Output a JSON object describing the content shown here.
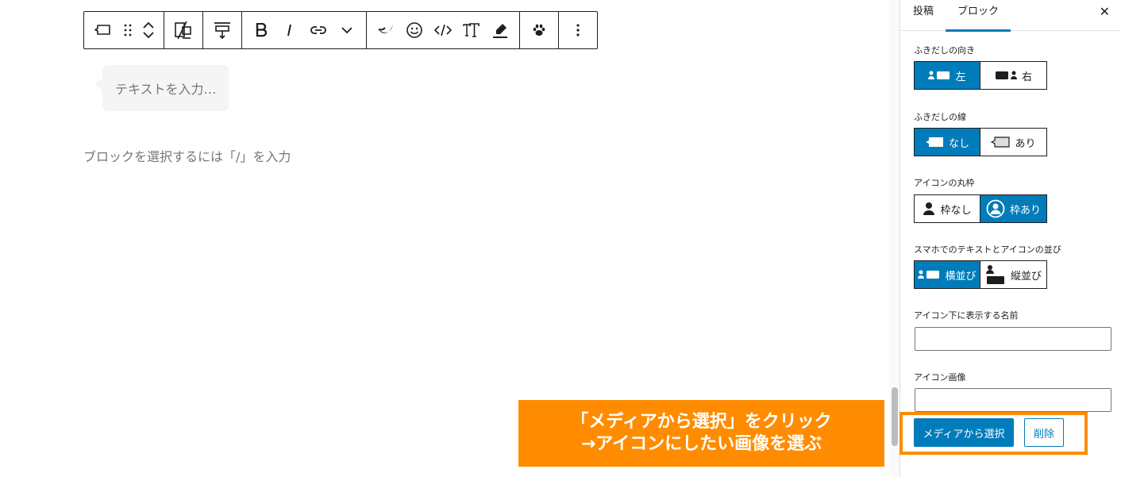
{
  "editor": {
    "bubble_placeholder": "テキストを入力…",
    "block_prompt": "ブロックを選択するには「/」を入力"
  },
  "toolbar": {
    "groups": [
      [
        "balloon-block-icon",
        "drag-handle-icon",
        "move-up-down-icon"
      ],
      [
        "mobile-hide-icon"
      ],
      [
        "align-vertical-icon"
      ],
      [
        "bold-icon",
        "italic-icon",
        "link-icon",
        "chevron-down-icon"
      ],
      [
        "brand-highlight-icon",
        "emoji-icon",
        "code-icon",
        "text-size-icon",
        "marker-icon"
      ],
      [
        "paw-icon"
      ],
      [
        "more-options-icon"
      ]
    ]
  },
  "sidebar": {
    "tabs": [
      {
        "label": "投稿",
        "active": false
      },
      {
        "label": "ブロック",
        "active": true
      }
    ],
    "close_glyph": "✕",
    "settings": {
      "direction": {
        "label": "ふきだしの向き",
        "options": [
          "左",
          "右"
        ],
        "selected": "左"
      },
      "border": {
        "label": "ふきだしの線",
        "options": [
          "なし",
          "あり"
        ],
        "selected": "なし"
      },
      "icon_frame": {
        "label": "アイコンの丸枠",
        "options": [
          "枠なし",
          "枠あり"
        ],
        "selected": "枠あり"
      },
      "mobile_layout": {
        "label": "スマホでのテキストとアイコンの並び",
        "options": [
          "横並び",
          "縦並び"
        ],
        "selected": "横並び"
      },
      "icon_name": {
        "label": "アイコン下に表示する名前",
        "value": "",
        "placeholder": ""
      },
      "icon_image": {
        "label": "アイコン画像",
        "value": "",
        "placeholder": ""
      }
    },
    "media_button": "メディアから選択",
    "delete_button": "削除"
  },
  "annotation": {
    "line1": "「メディアから選択」をクリック",
    "line2": "→アイコンにしたい画像を選ぶ"
  },
  "colors": {
    "accent": "#007cba",
    "callout": "#ff8c00",
    "placeholder_text": "#757575",
    "bubble_bg": "#f5f5f5"
  }
}
